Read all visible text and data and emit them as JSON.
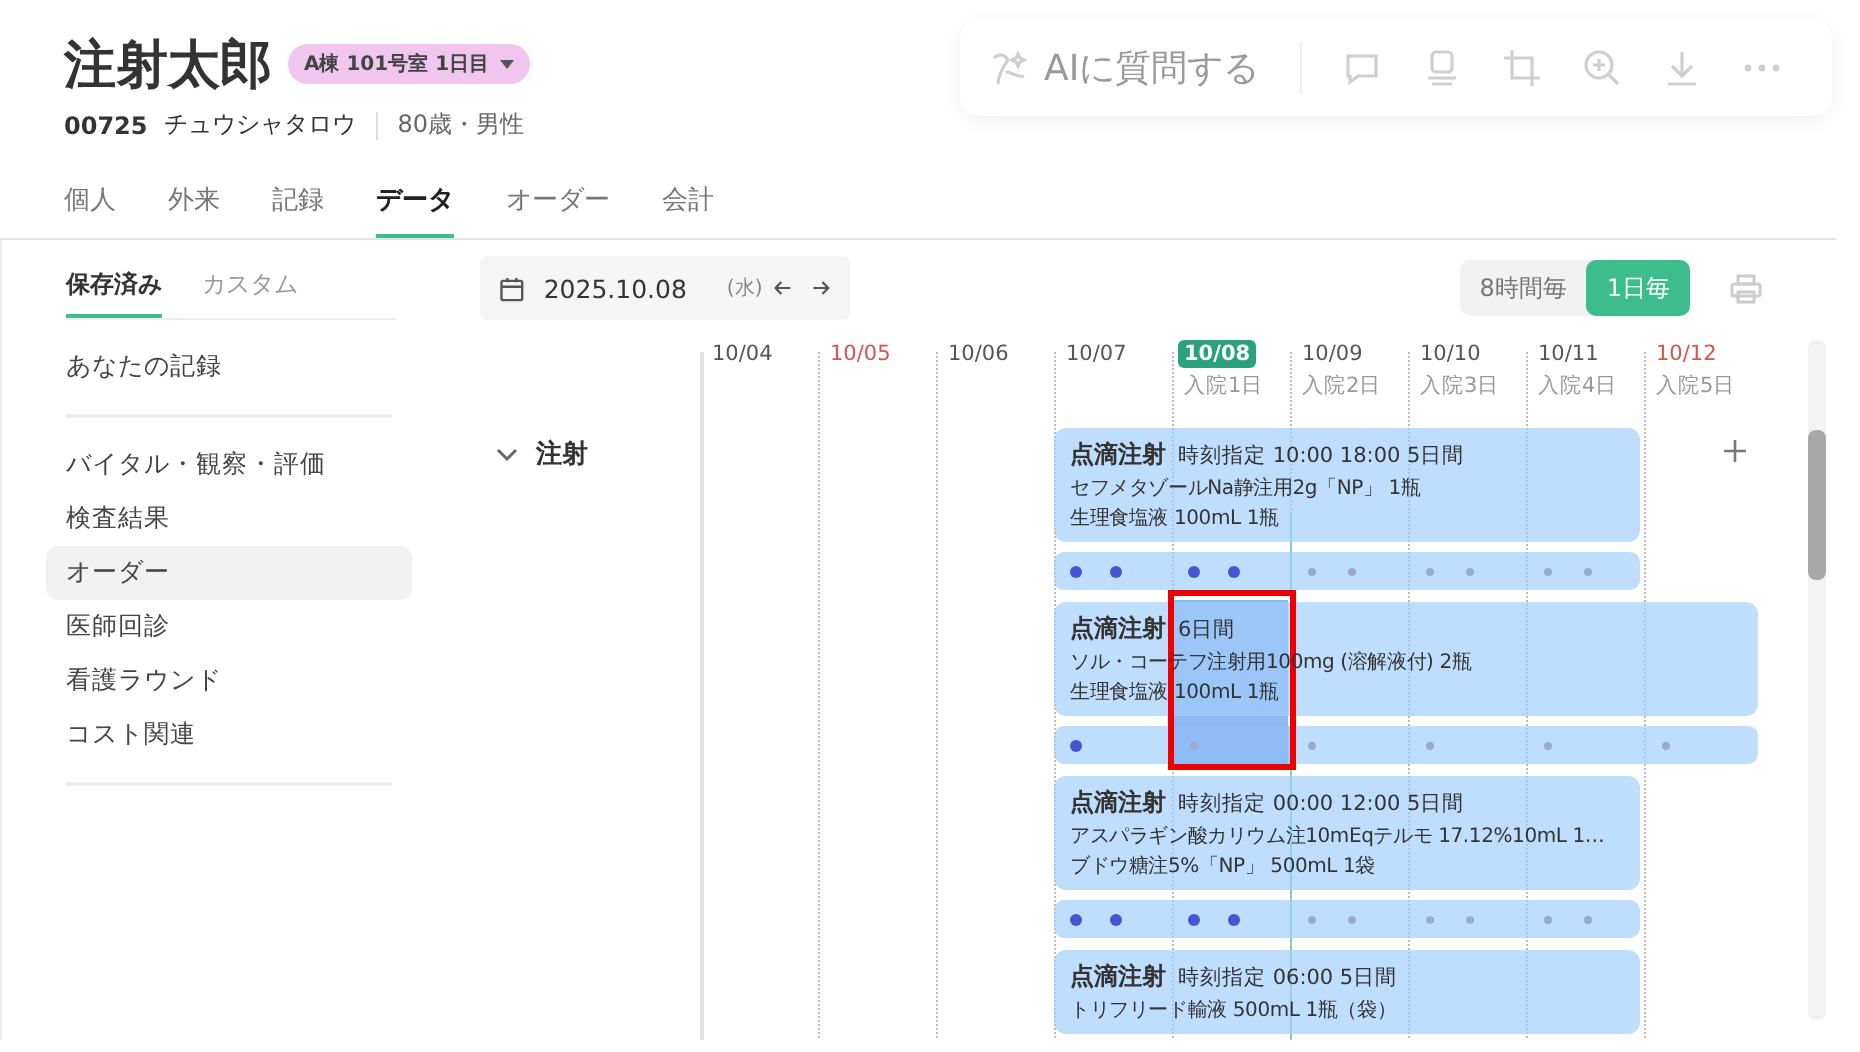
{
  "patient": {
    "name": "注射太郎",
    "room_badge": "A棟 101号室 1日目",
    "id": "00725",
    "kana": "チュウシャタロウ",
    "age_sex": "80歳・男性"
  },
  "toolbar": {
    "ai_label": "AIに質問する"
  },
  "tabs": [
    {
      "label": "個人",
      "selected": false
    },
    {
      "label": "外来",
      "selected": false
    },
    {
      "label": "記録",
      "selected": false
    },
    {
      "label": "データ",
      "selected": true
    },
    {
      "label": "オーダー",
      "selected": false
    },
    {
      "label": "会計",
      "selected": false
    }
  ],
  "sidebar": {
    "tabs": [
      {
        "label": "保存済み",
        "selected": true
      },
      {
        "label": "カスタム",
        "selected": false
      }
    ],
    "sections": [
      {
        "items": [
          {
            "label": "あなたの記録",
            "selected": false
          }
        ]
      },
      {
        "items": [
          {
            "label": "バイタル・観察・評価",
            "selected": false
          },
          {
            "label": "検査結果",
            "selected": false
          },
          {
            "label": "オーダー",
            "selected": true
          },
          {
            "label": "医師回診",
            "selected": false
          },
          {
            "label": "看護ラウンド",
            "selected": false
          },
          {
            "label": "コスト関連",
            "selected": false
          }
        ]
      }
    ]
  },
  "date_picker": {
    "date": "2025.10.08",
    "weekday": "(水)"
  },
  "interval_toggle": [
    {
      "label": "8時間毎",
      "selected": false
    },
    {
      "label": "1日毎",
      "selected": true
    }
  ],
  "timeline": {
    "days": [
      {
        "date": "10/04",
        "holiday": false,
        "today": false
      },
      {
        "date": "10/05",
        "holiday": true,
        "today": false
      },
      {
        "date": "10/06",
        "holiday": false,
        "today": false
      },
      {
        "date": "10/07",
        "holiday": false,
        "today": false
      },
      {
        "date": "10/08",
        "sub": "入院1日",
        "holiday": false,
        "today": true
      },
      {
        "date": "10/09",
        "sub": "入院2日",
        "holiday": false,
        "today": false
      },
      {
        "date": "10/10",
        "sub": "入院3日",
        "holiday": false,
        "today": false
      },
      {
        "date": "10/11",
        "sub": "入院4日",
        "holiday": false,
        "today": false
      },
      {
        "date": "10/12",
        "sub": "入院5日",
        "holiday": true,
        "today": false
      }
    ],
    "group": {
      "label": "注射",
      "expanded": true
    },
    "orders": [
      {
        "title": "点滴注射",
        "detail": "時刻指定 10:00 18:00 5日間",
        "lines": [
          "セフメタゾールNa静注用2g「NP」 1瓶",
          "生理食塩液 100mL 1瓶"
        ],
        "cells": [
          {
            "kind": "empty"
          },
          {
            "kind": "empty"
          },
          {
            "kind": "empty"
          },
          {
            "kind": "day",
            "selected": false,
            "doses": [
              {
                "given": true
              },
              {
                "given": true
              }
            ]
          },
          {
            "kind": "day",
            "selected": false,
            "doses": [
              {
                "given": true
              },
              {
                "given": true
              }
            ]
          },
          {
            "kind": "day",
            "selected": false,
            "doses": [
              {
                "given": false
              },
              {
                "given": false
              }
            ]
          },
          {
            "kind": "day",
            "selected": false,
            "doses": [
              {
                "given": false
              },
              {
                "given": false
              }
            ]
          },
          {
            "kind": "day",
            "selected": false,
            "doses": [
              {
                "given": false
              },
              {
                "given": false
              }
            ]
          },
          {
            "kind": "empty"
          }
        ]
      },
      {
        "title": "点滴注射",
        "detail": "6日間",
        "lines": [
          "ソル・コーテフ注射用100mg (溶解液付) 2瓶",
          "生理食塩液 100mL 1瓶"
        ],
        "cells": [
          {
            "kind": "empty"
          },
          {
            "kind": "empty"
          },
          {
            "kind": "empty"
          },
          {
            "kind": "day",
            "selected": false,
            "doses": [
              {
                "given": true
              }
            ]
          },
          {
            "kind": "day",
            "selected": true,
            "doses": [
              {
                "given": false
              }
            ]
          },
          {
            "kind": "day",
            "selected": false,
            "doses": [
              {
                "given": false
              }
            ]
          },
          {
            "kind": "day",
            "selected": false,
            "doses": [
              {
                "given": false
              }
            ]
          },
          {
            "kind": "day",
            "selected": false,
            "doses": [
              {
                "given": false
              }
            ]
          },
          {
            "kind": "day",
            "selected": false,
            "doses": [
              {
                "given": false
              }
            ]
          }
        ]
      },
      {
        "title": "点滴注射",
        "detail": "時刻指定 00:00 12:00 5日間",
        "lines": [
          "アスパラギン酸カリウム注10mEqテルモ 17.12%10mL 1…",
          "ブドウ糖注5%「NP」 500mL 1袋"
        ],
        "cells": [
          {
            "kind": "empty"
          },
          {
            "kind": "empty"
          },
          {
            "kind": "empty"
          },
          {
            "kind": "day",
            "selected": false,
            "doses": [
              {
                "given": true
              },
              {
                "given": true
              }
            ]
          },
          {
            "kind": "day",
            "selected": false,
            "doses": [
              {
                "given": true
              },
              {
                "given": true
              }
            ]
          },
          {
            "kind": "day",
            "selected": false,
            "doses": [
              {
                "given": false
              },
              {
                "given": false
              }
            ]
          },
          {
            "kind": "day",
            "selected": false,
            "doses": [
              {
                "given": false
              },
              {
                "given": false
              }
            ]
          },
          {
            "kind": "day",
            "selected": false,
            "doses": [
              {
                "given": false
              },
              {
                "given": false
              }
            ]
          },
          {
            "kind": "empty"
          }
        ]
      },
      {
        "title": "点滴注射",
        "detail": "時刻指定 06:00 5日間",
        "lines": [
          "トリフリード輸液 500mL 1瓶（袋）"
        ],
        "cells": [
          {
            "kind": "empty"
          },
          {
            "kind": "empty"
          },
          {
            "kind": "empty"
          },
          {
            "kind": "day"
          },
          {
            "kind": "day"
          },
          {
            "kind": "day"
          },
          {
            "kind": "day"
          },
          {
            "kind": "day"
          },
          {
            "kind": "empty"
          }
        ]
      }
    ]
  }
}
